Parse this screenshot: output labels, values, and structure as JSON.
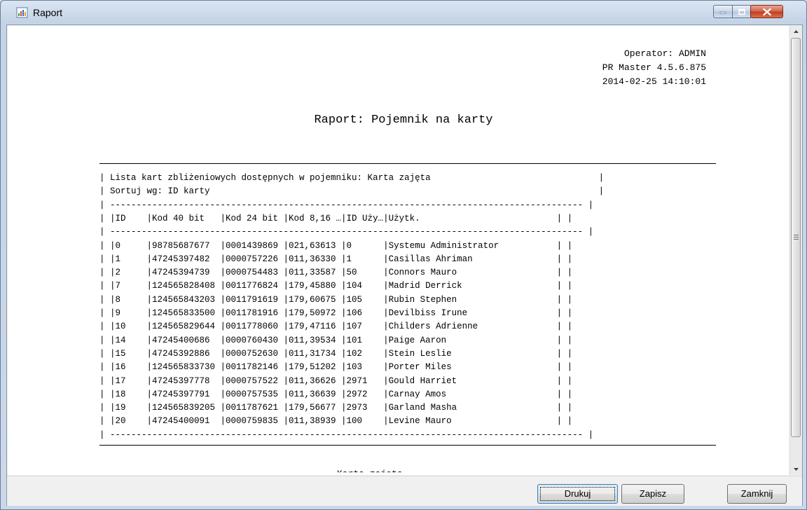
{
  "window": {
    "title": "Raport",
    "icons": {
      "app": "report-app-icon",
      "minimize": "minimize-icon",
      "maximize": "maximize-icon",
      "close": "close-icon"
    }
  },
  "report": {
    "operator": "Operator: ADMIN",
    "version": "PR Master 4.5.6.875",
    "datetime": "2014-02-25 14:10:01",
    "title": "Raport: Pojemnik na karty",
    "lines": [
      "| Lista kart zbliżeniowych dostępnych w pojemniku: Karta zajęta                                |",
      "| Sortuj wg: ID karty                                                                          |",
      "| ------------------------------------------------------------------------------------------ |",
      "| |ID    |Kod 40 bit   |Kod 24 bit |Kod 8,16 …|ID Uży…|Użytk.                          | |",
      "| ------------------------------------------------------------------------------------------ |",
      "| |0     |98785687677  |0001439869 |021,63613 |0      |Systemu Administrator           | |",
      "| |1     |47245397482  |0000757226 |011,36330 |1      |Casillas Ahriman                | |",
      "| |2     |47245394739  |0000754483 |011,33587 |50     |Connors Mauro                   | |",
      "| |7     |124565828408 |0011776824 |179,45880 |104    |Madrid Derrick                  | |",
      "| |8     |124565843203 |0011791619 |179,60675 |105    |Rubin Stephen                   | |",
      "| |9     |124565833500 |0011781916 |179,50972 |106    |Devilbiss Irune                 | |",
      "| |10    |124565829644 |0011778060 |179,47116 |107    |Childers Adrienne               | |",
      "| |14    |47245400686  |0000760430 |011,39534 |101    |Paige Aaron                     | |",
      "| |15    |47245392886  |0000752630 |011,31734 |102    |Stein Leslie                    | |",
      "| |16    |124565833730 |0011782146 |179,51202 |103    |Porter Miles                    | |",
      "| |17    |47245397778  |0000757522 |011,36626 |2971   |Gould Harriet                   | |",
      "| |18    |47245397791  |0000757535 |011,36639 |2972   |Carnay Amos                     | |",
      "| |19    |124565839205 |0011787621 |179,56677 |2973   |Garland Masha                   | |",
      "| |20    |47245400091  |0000759835 |011,38939 |100    |Levine Mauro                    | |",
      "| ------------------------------------------------------------------------------------------ |"
    ],
    "cut_text": "Karta zajęta"
  },
  "scrollbar": {
    "up_icon": "scroll-up-arrow-icon",
    "down_icon": "scroll-down-arrow-icon",
    "grip_icon": "scroll-grip-icon"
  },
  "buttons": {
    "print": "Drukuj",
    "save": "Zapisz",
    "close": "Zamknij"
  }
}
